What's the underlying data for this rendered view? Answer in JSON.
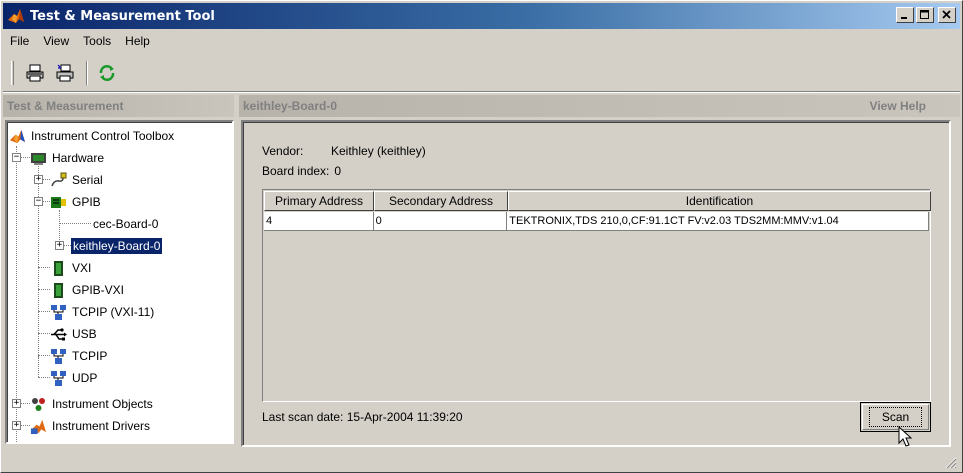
{
  "window": {
    "title": "Test & Measurement Tool",
    "controls": [
      "_",
      "□",
      "×"
    ]
  },
  "menu": [
    "File",
    "View",
    "Tools",
    "Help"
  ],
  "toolbar": {
    "buttons": [
      "print-icon",
      "print-preview-icon",
      "refresh-icon"
    ]
  },
  "left": {
    "header": "Test & Measurement",
    "tree": [
      {
        "label": "Instrument Control Toolbox",
        "icon": "matlab-icon"
      },
      {
        "label": "Hardware",
        "icon": "hardware-icon"
      },
      {
        "label": "Serial",
        "icon": "serial-icon"
      },
      {
        "label": "GPIB",
        "icon": "gpib-icon"
      },
      {
        "label": "cec-Board-0",
        "icon": ""
      },
      {
        "label": "keithley-Board-0",
        "icon": "",
        "selected": true
      },
      {
        "label": "VXI",
        "icon": "vxi-icon"
      },
      {
        "label": "GPIB-VXI",
        "icon": "gpib-vxi-icon"
      },
      {
        "label": "TCPIP (VXI-11)",
        "icon": "network-icon"
      },
      {
        "label": "USB",
        "icon": "usb-icon"
      },
      {
        "label": "TCPIP",
        "icon": "network-icon"
      },
      {
        "label": "UDP",
        "icon": "network-icon"
      },
      {
        "label": "Instrument Objects",
        "icon": "objects-icon"
      },
      {
        "label": "Instrument Drivers",
        "icon": "drivers-icon"
      }
    ]
  },
  "right": {
    "header": "keithley-Board-0",
    "view_help": "View Help",
    "vendor_label": "Vendor:",
    "vendor_value": "Keithley (keithley)",
    "board_index_label": "Board index:",
    "board_index_value": "0",
    "table": {
      "columns": [
        "Primary Address",
        "Secondary Address",
        "Identification"
      ],
      "rows": [
        [
          "4",
          "0",
          "TEKTRONIX,TDS 210,0,CF:91.1CT FV:v2.03 TDS2MM:MMV:v1.04"
        ]
      ]
    },
    "last_scan": "Last scan date: 15-Apr-2004 11:39:20",
    "scan_button": "Scan"
  },
  "colors": {
    "title_start": "#0a246a",
    "title_end": "#a6caf0",
    "selection": "#0a246a",
    "face": "#d4d0c8"
  }
}
